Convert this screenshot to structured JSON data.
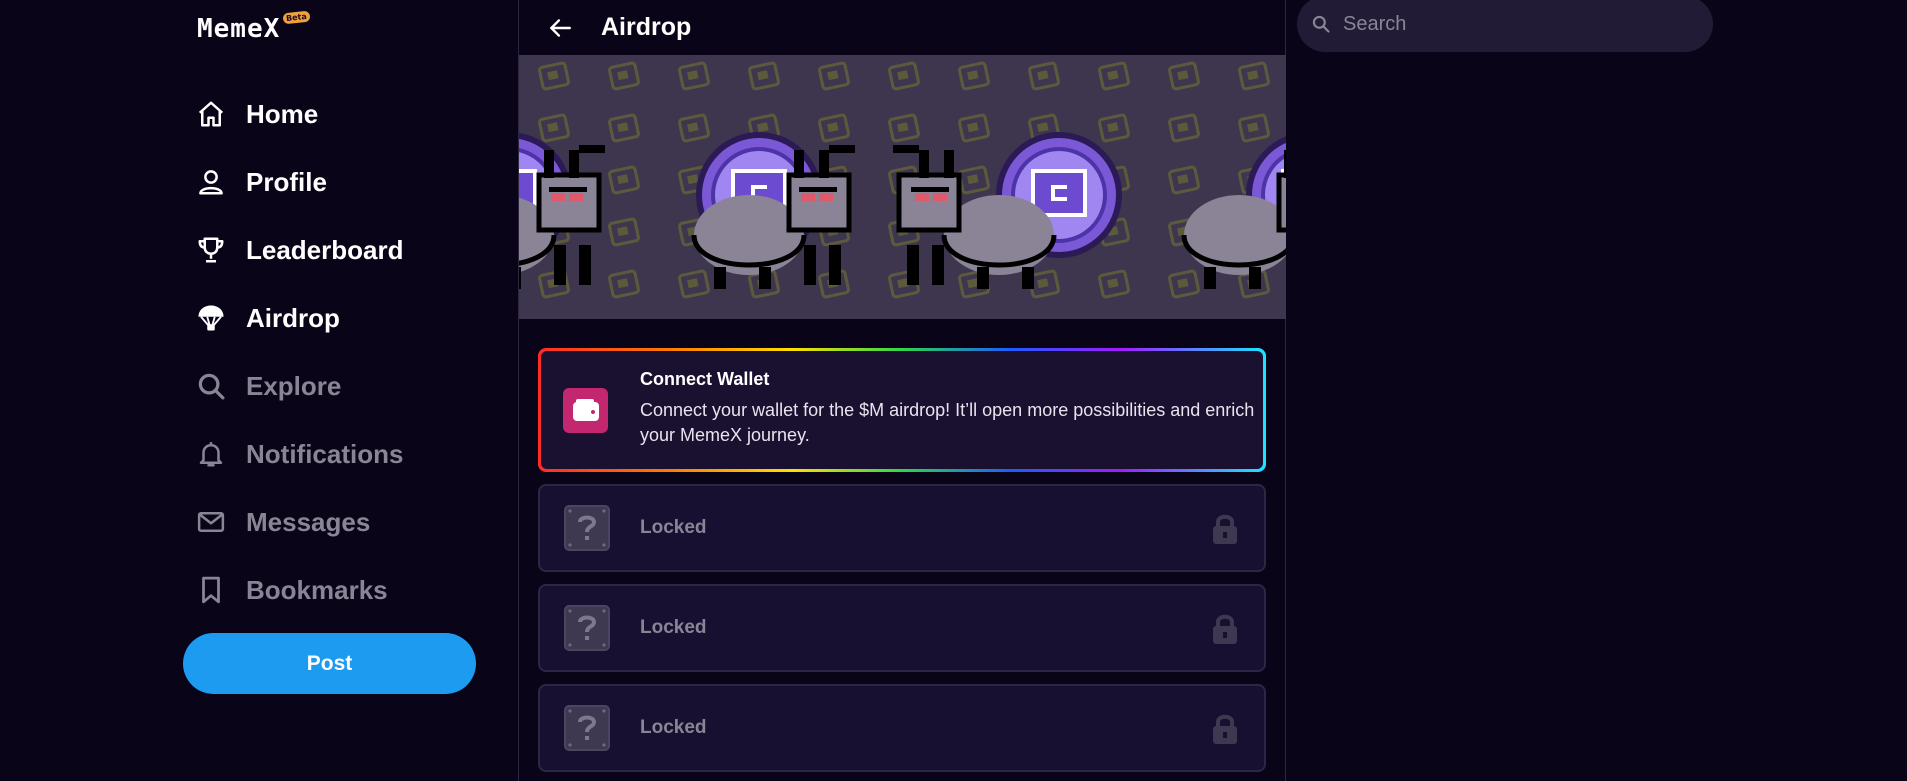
{
  "brand": {
    "name": "MemeX",
    "badge": "Beta"
  },
  "nav": {
    "items": [
      {
        "label": "Home",
        "icon": "home-icon",
        "state": "normal"
      },
      {
        "label": "Profile",
        "icon": "user-icon",
        "state": "normal"
      },
      {
        "label": "Leaderboard",
        "icon": "trophy-icon",
        "state": "normal"
      },
      {
        "label": "Airdrop",
        "icon": "parachute-icon",
        "state": "active"
      },
      {
        "label": "Explore",
        "icon": "search-icon",
        "state": "dim"
      },
      {
        "label": "Notifications",
        "icon": "bell-icon",
        "state": "dim"
      },
      {
        "label": "Messages",
        "icon": "mail-icon",
        "state": "dim"
      },
      {
        "label": "Bookmarks",
        "icon": "bookmark-icon",
        "state": "dim"
      }
    ],
    "post_label": "Post"
  },
  "header": {
    "title": "Airdrop"
  },
  "wallet_card": {
    "title": "Connect Wallet",
    "description": "Connect your wallet for the $M airdrop! It’ll open more possibilities and enrich your MemeX journey."
  },
  "locked_cards": [
    {
      "label": "Locked"
    },
    {
      "label": "Locked"
    },
    {
      "label": "Locked"
    }
  ],
  "search": {
    "placeholder": "Search"
  },
  "colors": {
    "background": "#0a0419",
    "accent_blue": "#1d9bf0",
    "wallet_pink": "#c2276f",
    "card_bg": "#171030",
    "muted_text": "#8a8595"
  }
}
